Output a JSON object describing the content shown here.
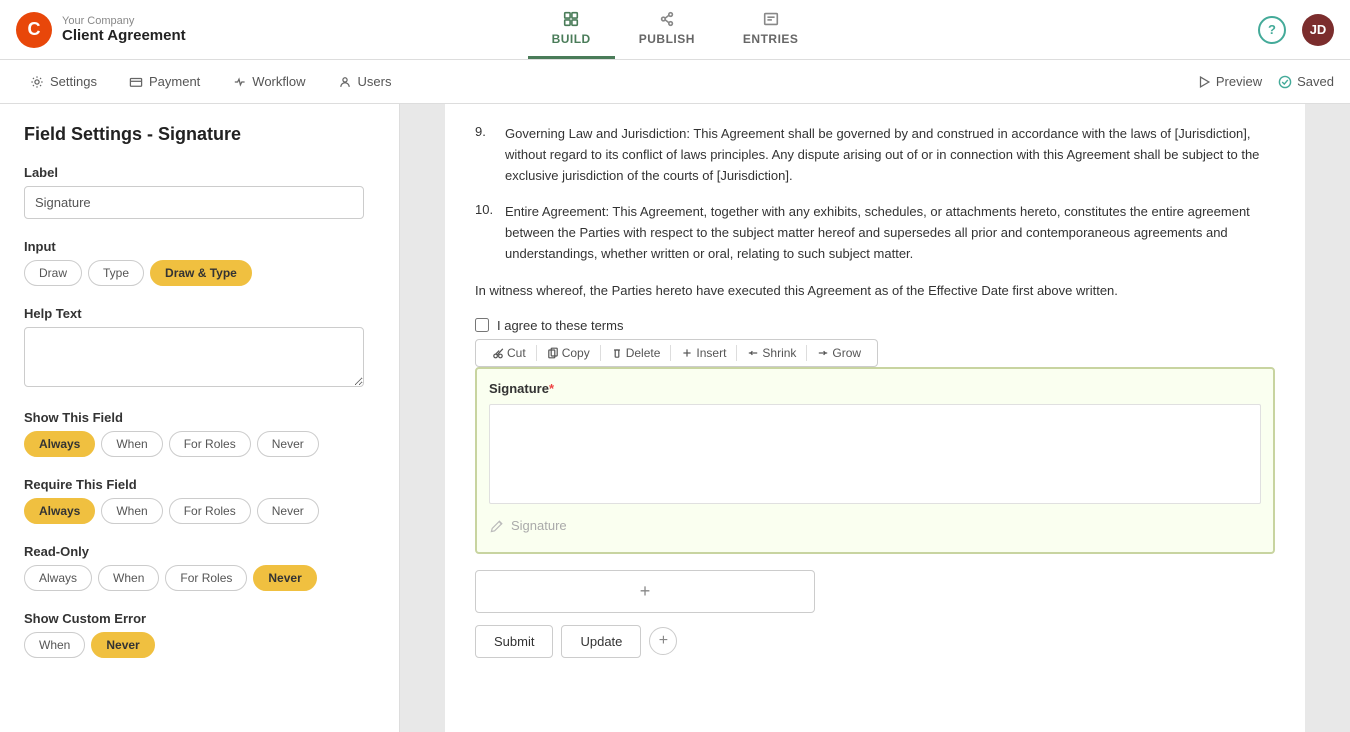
{
  "app": {
    "company": "Your Company",
    "product": "Client Agreement",
    "logo_letter": "C"
  },
  "nav": {
    "tabs": [
      {
        "id": "build",
        "label": "BUILD",
        "active": true
      },
      {
        "id": "publish",
        "label": "PUBLISH",
        "active": false
      },
      {
        "id": "entries",
        "label": "ENTRIES",
        "active": false
      }
    ],
    "help_label": "?",
    "avatar_initials": "JD"
  },
  "subnav": {
    "items": [
      {
        "id": "settings",
        "label": "Settings",
        "icon": "settings"
      },
      {
        "id": "payment",
        "label": "Payment",
        "icon": "payment"
      },
      {
        "id": "workflow",
        "label": "Workflow",
        "icon": "workflow"
      },
      {
        "id": "users",
        "label": "Users",
        "icon": "users"
      }
    ],
    "preview_label": "Preview",
    "saved_label": "Saved"
  },
  "field_settings": {
    "title": "Field Settings - Signature",
    "label_field": {
      "label": "Label",
      "value": "Signature",
      "placeholder": "Signature"
    },
    "input_field": {
      "label": "Input",
      "options": [
        {
          "id": "draw",
          "label": "Draw",
          "active": false
        },
        {
          "id": "type",
          "label": "Type",
          "active": false
        },
        {
          "id": "draw_type",
          "label": "Draw & Type",
          "active": true
        }
      ]
    },
    "help_text_field": {
      "label": "Help Text",
      "value": "",
      "placeholder": ""
    },
    "show_this_field": {
      "label": "Show This Field",
      "options": [
        {
          "id": "always",
          "label": "Always",
          "active": true
        },
        {
          "id": "when",
          "label": "When",
          "active": false
        },
        {
          "id": "for_roles",
          "label": "For Roles",
          "active": false
        },
        {
          "id": "never",
          "label": "Never",
          "active": false
        }
      ]
    },
    "require_this_field": {
      "label": "Require This Field",
      "options": [
        {
          "id": "always",
          "label": "Always",
          "active": true
        },
        {
          "id": "when",
          "label": "When",
          "active": false
        },
        {
          "id": "for_roles",
          "label": "For Roles",
          "active": false
        },
        {
          "id": "never",
          "label": "Never",
          "active": false
        }
      ]
    },
    "read_only": {
      "label": "Read-Only",
      "options": [
        {
          "id": "always",
          "label": "Always",
          "active": false
        },
        {
          "id": "when",
          "label": "When",
          "active": false
        },
        {
          "id": "for_roles",
          "label": "For Roles",
          "active": false
        },
        {
          "id": "never",
          "label": "Never",
          "active": true
        }
      ]
    },
    "show_custom_error": {
      "label": "Show Custom Error",
      "options": [
        {
          "id": "when",
          "label": "When",
          "active": false
        },
        {
          "id": "never",
          "label": "Never",
          "active": true
        }
      ]
    }
  },
  "agreement": {
    "items": [
      {
        "num": "9.",
        "text": "Governing Law and Jurisdiction: This Agreement shall be governed by and construed in accordance with the laws of [Jurisdiction], without regard to its conflict of laws principles. Any dispute arising out of or in connection with this Agreement shall be subject to the exclusive jurisdiction of the courts of [Jurisdiction]."
      },
      {
        "num": "10.",
        "text": "Entire Agreement: This Agreement, together with any exhibits, schedules, or attachments hereto, constitutes the entire agreement between the Parties with respect to the subject matter hereof and supersedes all prior and contemporaneous agreements and understandings, whether written or oral, relating to such subject matter."
      }
    ],
    "witness_text": "In witness whereof, the Parties hereto have executed this Agreement as of the Effective Date first above written.",
    "checkbox_label": "I agree to these terms",
    "toolbar": {
      "cut": "Cut",
      "copy": "Copy",
      "delete": "Delete",
      "insert": "Insert",
      "shrink": "Shrink",
      "grow": "Grow"
    },
    "signature_label": "Signature",
    "signature_required": "*",
    "signature_placeholder": "Signature"
  },
  "form_actions": {
    "submit_label": "Submit",
    "update_label": "Update",
    "add_plus": "+"
  }
}
